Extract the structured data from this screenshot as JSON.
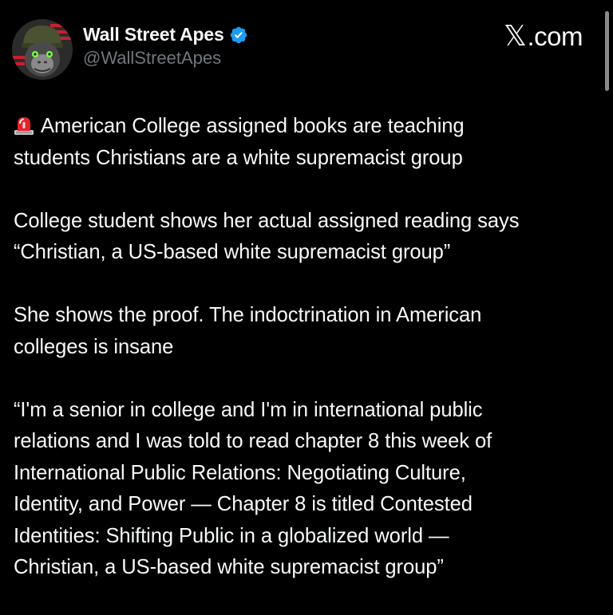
{
  "author": {
    "name": "Wall Street Apes",
    "handle": "@WallStreetApes",
    "verified": true
  },
  "brand": {
    "x_glyph": "𝕏",
    "suffix": ".com"
  },
  "icons": {
    "avatar": "ape-soldier-avatar",
    "verified": "verified-badge-icon",
    "siren": "police-siren-emoji"
  },
  "colors": {
    "background": "#000000",
    "text": "#f7f9f9",
    "secondary": "#71767b",
    "verified_blue": "#1d9bf0",
    "siren_red": "#e8202a"
  },
  "post": {
    "paragraphs": [
      {
        "lines": [
          "American College assigned books are teaching",
          "students Christians are a white supremacist group"
        ]
      },
      {
        "lines": [
          "College student shows her actual assigned reading says",
          "“Christian, a US-based white supremacist group”"
        ]
      },
      {
        "lines": [
          "She shows the proof. The indoctrination in American",
          "colleges is insane"
        ]
      },
      {
        "lines": [
          "“I'm a senior in college and I'm in international public",
          "relations and I was told to read chapter 8 this week of",
          "International Public Relations: Negotiating Culture,",
          "Identity, and Power — Chapter 8 is titled Contested",
          "Identities: Shifting Public in a globalized world —",
          "Christian, a US-based white supremacist group”"
        ]
      }
    ]
  }
}
